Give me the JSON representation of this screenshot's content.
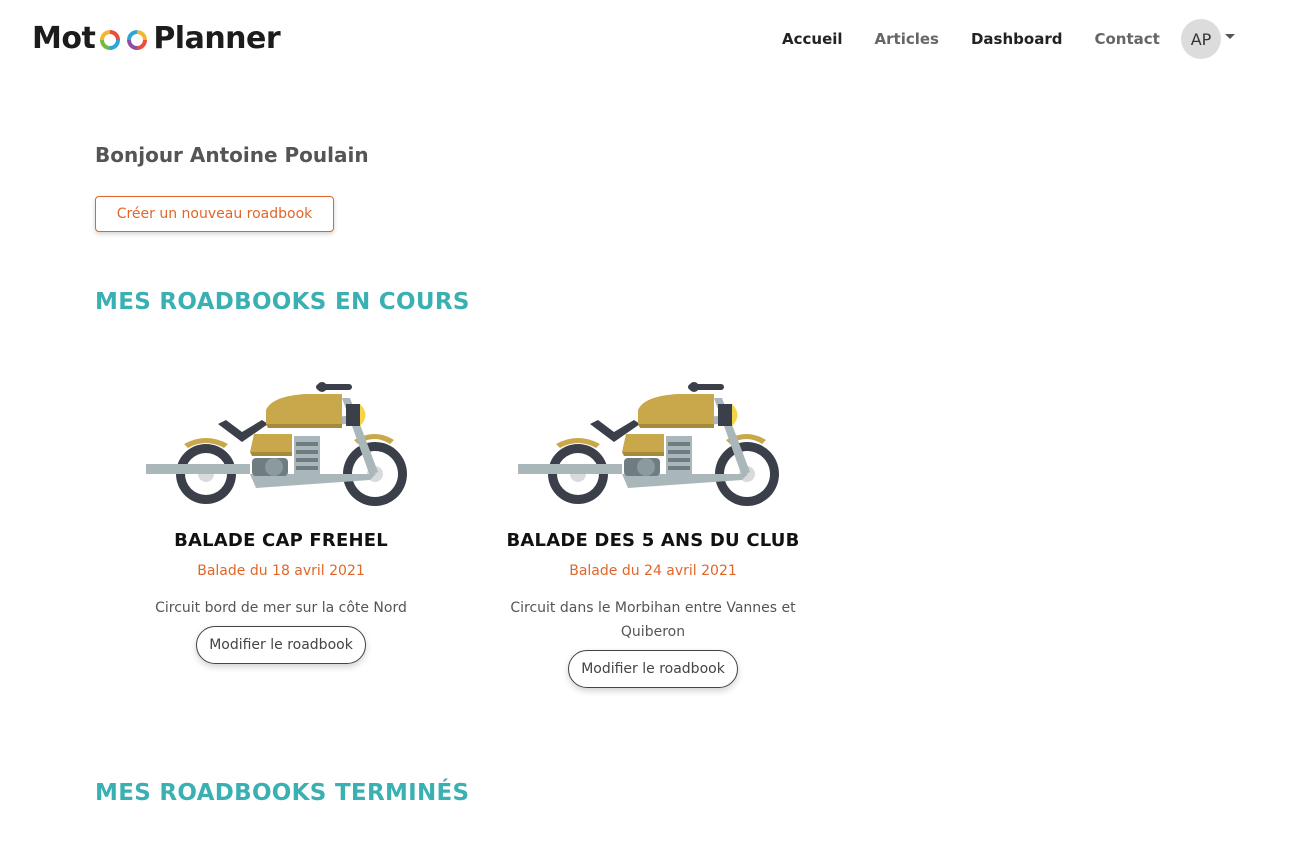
{
  "brand": {
    "prefix": "Mot",
    "suffix": "Planner"
  },
  "nav": {
    "items": [
      {
        "label": "Accueil"
      },
      {
        "label": "Articles"
      },
      {
        "label": "Dashboard"
      },
      {
        "label": "Contact"
      }
    ],
    "user_initials": "AP"
  },
  "greeting": "Bonjour Antoine Poulain",
  "create_button": "Créer un nouveau roadbook",
  "sections": {
    "current_title": "MES ROADBOOKS EN COURS",
    "done_title": "MES ROADBOOKS TERMINÉS"
  },
  "roadbooks": [
    {
      "title": "BALADE CAP FREHEL",
      "date": "Balade du 18 avril 2021",
      "description": "Circuit bord de mer sur la côte Nord",
      "button": "Modifier le roadbook",
      "icon": "motorcycle-icon"
    },
    {
      "title": "BALADE DES 5 ANS DU CLUB",
      "date": "Balade du 24 avril 2021",
      "description": "Circuit dans le Morbihan entre Vannes et Quiberon",
      "button": "Modifier le roadbook",
      "icon": "motorcycle-icon"
    }
  ],
  "colors": {
    "accent_orange": "#e0662a",
    "section_teal": "#3bb0b3",
    "tank_gold": "#c8a84b",
    "frame_grey": "#a9b6ba",
    "tire_dark": "#3a3f4a"
  }
}
